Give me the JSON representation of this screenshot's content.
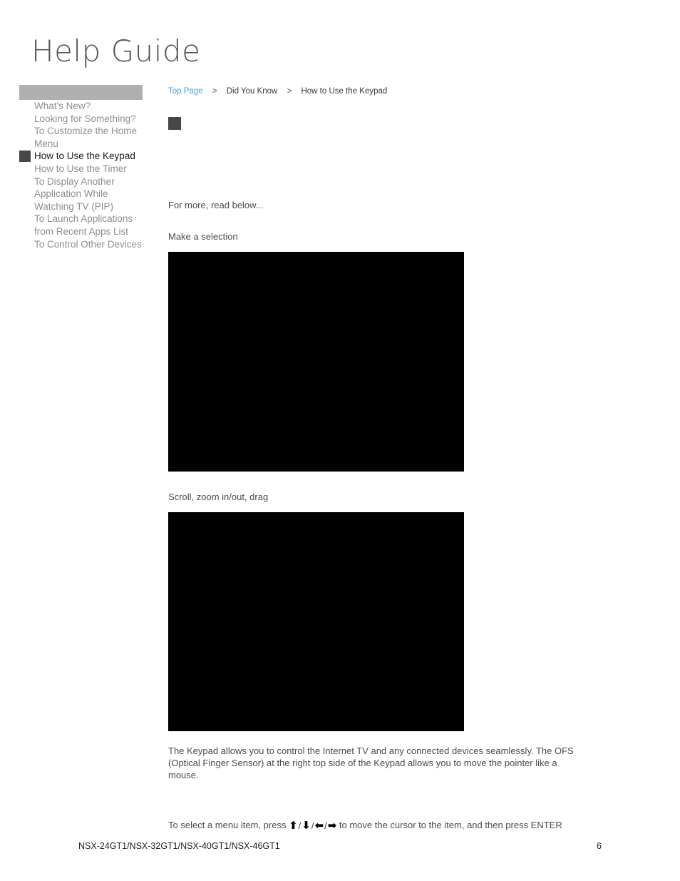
{
  "masthead": {
    "title": "Help Guide"
  },
  "sidebar": {
    "items": [
      {
        "label": "What's New?",
        "current": false
      },
      {
        "label": "Looking for Something?",
        "current": false
      },
      {
        "label": "To Customize the Home Menu",
        "current": false
      },
      {
        "label": "How to Use the Keypad",
        "current": true
      },
      {
        "label": "How to Use the Timer",
        "current": false
      },
      {
        "label": "To Display Another Application While Watching TV (PIP)",
        "current": false
      },
      {
        "label": "To Launch Applications from Recent Apps List",
        "current": false
      },
      {
        "label": "To Control Other Devices",
        "current": false
      }
    ]
  },
  "breadcrumb": {
    "top": "Top Page",
    "sep1": ">",
    "middle": "Did You Know",
    "sep2": ">",
    "current": "How to Use the Keypad"
  },
  "main": {
    "lede": "For more, read below...",
    "section_1_caption": "Make a selection",
    "section_2_caption": "Scroll, zoom in/out, drag",
    "body_paragraph": "The Keypad allows you to control the Internet TV and any connected devices seamlessly. The OFS (Optical Finger Sensor) at the right top side of the Keypad allows you to move the pointer like a mouse.",
    "keys_prefix": "To select a menu item, press ",
    "key_up": "⬆",
    "key_down": "⬇",
    "key_left": "⬅",
    "key_right": "➡",
    "key_sep": "/",
    "keys_suffix": " to move the cursor to the item, and then press ENTER"
  },
  "footer": {
    "model": "NSX-24GT1/NSX-32GT1/NSX-40GT1/NSX-46GT1",
    "page_number": "6"
  },
  "colors": {
    "link": "#4a9fd8",
    "sidebar_bar": "#b0b0b0",
    "marker": "#474747",
    "body_text": "#4b4b4b",
    "muted_text": "#8f8f8f"
  }
}
